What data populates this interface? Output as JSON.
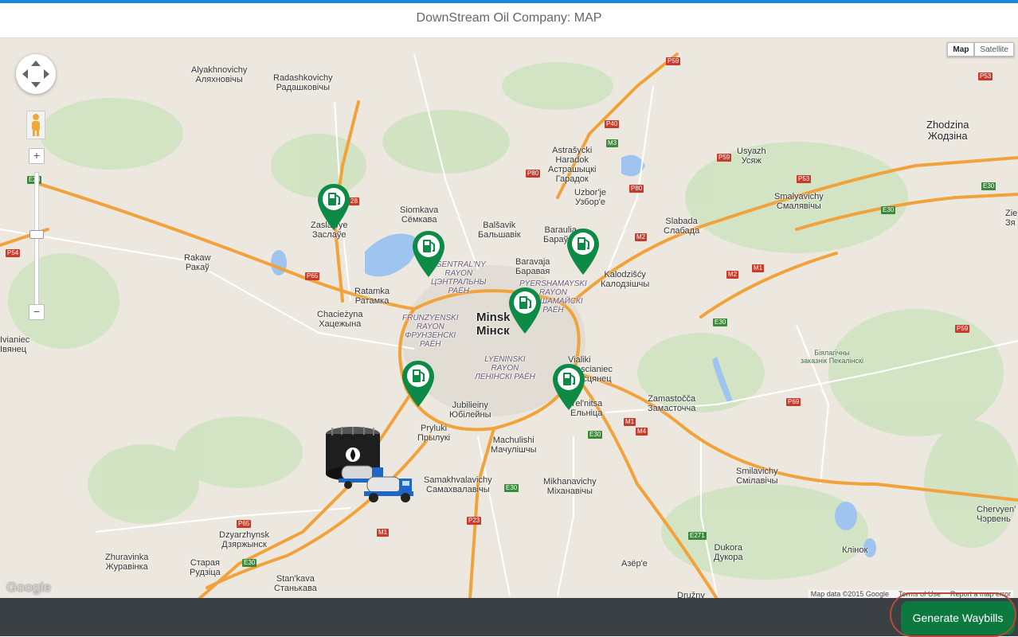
{
  "header": {
    "title": "DownStream Oil Company: MAP"
  },
  "map_controls": {
    "map_type": [
      "Map",
      "Satellite"
    ],
    "zoom_in": "+",
    "zoom_out": "−",
    "logo": "Google",
    "attribution": [
      "Map data ©2015 Google",
      "Terms of Use",
      "Report a map error"
    ]
  },
  "labels": [
    {
      "id": "alyakhnovichy",
      "lines": [
        "Alyakhnovichy",
        "Аляхновічы"
      ],
      "kind": "town"
    },
    {
      "id": "radashkovichy",
      "lines": [
        "Radashkovichy",
        "Радашковічы"
      ],
      "kind": "town"
    },
    {
      "id": "zhodzina",
      "lines": [
        "Zhodzina",
        "Жодзіна"
      ],
      "kind": "mid"
    },
    {
      "id": "astrashycki",
      "lines": [
        "Astrašycki",
        "Haradok",
        "Астрашыцкі",
        "Гарадок"
      ],
      "kind": "town"
    },
    {
      "id": "usyazh",
      "lines": [
        "Usyazh",
        "Усяж"
      ],
      "kind": "town"
    },
    {
      "id": "uzborje",
      "lines": [
        "Uzbor'je",
        "Узбор'е"
      ],
      "kind": "town"
    },
    {
      "id": "smalyavichy",
      "lines": [
        "Smalyavichy",
        "Смалявічы"
      ],
      "kind": "town"
    },
    {
      "id": "zaslawye",
      "lines": [
        "Zaslawye",
        "Заслаўе"
      ],
      "kind": "town"
    },
    {
      "id": "siomkava",
      "lines": [
        "Siomkava",
        "Сёмкава"
      ],
      "kind": "town"
    },
    {
      "id": "balsavik",
      "lines": [
        "Balšavik",
        "Бальшавік"
      ],
      "kind": "town"
    },
    {
      "id": "baraulia",
      "lines": [
        "Baraulia",
        "Бараўля"
      ],
      "kind": "town"
    },
    {
      "id": "slabada",
      "lines": [
        "Slabada",
        "Слабада"
      ],
      "kind": "town"
    },
    {
      "id": "rakaw",
      "lines": [
        "Rakaw",
        "Ракаў"
      ],
      "kind": "town"
    },
    {
      "id": "baravaja",
      "lines": [
        "Baravaja",
        "Баравая"
      ],
      "kind": "town"
    },
    {
      "id": "kalodzisca",
      "lines": [
        "Kalodzišćy",
        "Калодзішчы"
      ],
      "kind": "town"
    },
    {
      "id": "ratamka",
      "lines": [
        "Ratamka",
        "Ратамка"
      ],
      "kind": "town"
    },
    {
      "id": "chaciezyna",
      "lines": [
        "Chacieżyna",
        "Хацежына"
      ],
      "kind": "town"
    },
    {
      "id": "minsk",
      "lines": [
        "Minsk",
        "Мінск"
      ],
      "kind": "big"
    },
    {
      "id": "ivianiec",
      "lines": [
        "Ivianiec",
        "Івянец"
      ],
      "kind": "town"
    },
    {
      "id": "vialiki",
      "lines": [
        "Vialiki",
        "Trascianiec",
        "Трасцянец"
      ],
      "kind": "town"
    },
    {
      "id": "zamastocca",
      "lines": [
        "Zamastočča",
        "Замасточча"
      ],
      "kind": "town"
    },
    {
      "id": "jubilieiny",
      "lines": [
        "Jubilieinу",
        "Юбілейны"
      ],
      "kind": "town"
    },
    {
      "id": "yelnitsa",
      "lines": [
        "Yel'nitsa",
        "Ельніца"
      ],
      "kind": "town"
    },
    {
      "id": "pryluki",
      "lines": [
        "Pryluki",
        "Прылукі"
      ],
      "kind": "town"
    },
    {
      "id": "machulishi",
      "lines": [
        "Machulishi",
        "Мачулішчы"
      ],
      "kind": "town"
    },
    {
      "id": "samakhvalavichy",
      "lines": [
        "Samakhvalavichy",
        "Самахвалавічы"
      ],
      "kind": "town"
    },
    {
      "id": "mikhanavichy",
      "lines": [
        "Mikhanavichy",
        "Міханавічы"
      ],
      "kind": "town"
    },
    {
      "id": "smilavichy",
      "lines": [
        "Smilavichy",
        "Смілавічы"
      ],
      "kind": "town"
    },
    {
      "id": "cherven",
      "lines": [
        "Chervyen'",
        "Чэрвень"
      ],
      "kind": "town"
    },
    {
      "id": "klinok",
      "lines": [
        "Клінок"
      ],
      "kind": "town"
    },
    {
      "id": "dzyarzhynsk",
      "lines": [
        "Dzyarzhynsk",
        "Дзяржынск"
      ],
      "kind": "town"
    },
    {
      "id": "zhuravinka",
      "lines": [
        "Zhuravinka",
        "Журавінка"
      ],
      "kind": "town"
    },
    {
      "id": "staraya",
      "lines": [
        "Старая",
        "Рудзіца"
      ],
      "kind": "town"
    },
    {
      "id": "stankava",
      "lines": [
        "Stan'kava",
        "Станькава"
      ],
      "kind": "town"
    },
    {
      "id": "dukora",
      "lines": [
        "Dukora",
        "Дукора"
      ],
      "kind": "town"
    },
    {
      "id": "azere",
      "lines": [
        "Азёр'е"
      ],
      "kind": "town"
    },
    {
      "id": "druzhny",
      "lines": [
        "Družny"
      ],
      "kind": "town"
    },
    {
      "id": "zie",
      "lines": [
        "Zie",
        "Зя"
      ],
      "kind": "town"
    },
    {
      "id": "tsentralny",
      "lines": [
        "TSENTRAL'NY",
        "RAYON",
        "ЦЭНТРАЛЬНЫ",
        "РАЁН"
      ],
      "kind": "dist"
    },
    {
      "id": "pyershamayski",
      "lines": [
        "PYERSHAMAYSKI",
        "RAYON",
        "ПЕРШАМАЙСКІ",
        "РАЁН"
      ],
      "kind": "dist"
    },
    {
      "id": "frunzyenski",
      "lines": [
        "FRUNZYENSKI",
        "RAYON",
        "ФРУНЗЕНСКІ",
        "РАЁН"
      ],
      "kind": "dist"
    },
    {
      "id": "lyeninski",
      "lines": [
        "LYENINSKI",
        "RAYON",
        "ЛЕНІНСКІ РАЁН"
      ],
      "kind": "dist"
    },
    {
      "id": "pekalinski",
      "lines": [
        "Біялагічны",
        "заказнік Пекалінскі"
      ],
      "kind": "park"
    }
  ],
  "road_shields": [
    {
      "id": "p59a",
      "text": "P59",
      "color": "red"
    },
    {
      "id": "p53",
      "text": "P53",
      "color": "red"
    },
    {
      "id": "p40",
      "text": "P40",
      "color": "red"
    },
    {
      "id": "m3",
      "text": "M3",
      "color": "green"
    },
    {
      "id": "p80a",
      "text": "P80",
      "color": "red"
    },
    {
      "id": "p59b",
      "text": "P59",
      "color": "red"
    },
    {
      "id": "p53b",
      "text": "P53",
      "color": "red"
    },
    {
      "id": "e30a",
      "text": "E30",
      "color": "green"
    },
    {
      "id": "e30b",
      "text": "E30",
      "color": "green"
    },
    {
      "id": "e28",
      "text": "E28",
      "color": "green"
    },
    {
      "id": "p80b",
      "text": "P80",
      "color": "red"
    },
    {
      "id": "p28",
      "text": "28",
      "color": "red"
    },
    {
      "id": "m2a",
      "text": "M2",
      "color": "red"
    },
    {
      "id": "p54",
      "text": "P54",
      "color": "red"
    },
    {
      "id": "p65",
      "text": "P65",
      "color": "red"
    },
    {
      "id": "m1a",
      "text": "M1",
      "color": "red"
    },
    {
      "id": "m2b",
      "text": "M2",
      "color": "red"
    },
    {
      "id": "e30c",
      "text": "E30",
      "color": "green"
    },
    {
      "id": "p59c",
      "text": "P59",
      "color": "red"
    },
    {
      "id": "p69",
      "text": "P69",
      "color": "red"
    },
    {
      "id": "m1b",
      "text": "M1",
      "color": "red"
    },
    {
      "id": "m4",
      "text": "M4",
      "color": "red"
    },
    {
      "id": "e30d",
      "text": "E30",
      "color": "green"
    },
    {
      "id": "e30e",
      "text": "E30",
      "color": "green"
    },
    {
      "id": "p23",
      "text": "P23",
      "color": "red"
    },
    {
      "id": "p65b",
      "text": "P65",
      "color": "red"
    },
    {
      "id": "m1c",
      "text": "M1",
      "color": "red"
    },
    {
      "id": "e271",
      "text": "E271",
      "color": "green"
    },
    {
      "id": "e30f",
      "text": "E30",
      "color": "green"
    }
  ],
  "stations": [
    "station-1",
    "station-2",
    "station-3",
    "station-4",
    "station-5",
    "station-6"
  ],
  "depot": {
    "name": "oil-depot-with-trucks"
  },
  "footer": {
    "generate_label": "Generate Waybills"
  },
  "colors": {
    "marker": "#0c8a46",
    "button": "#0c7a3e",
    "highway": "#f2a23a",
    "footer": "#3b4045"
  }
}
